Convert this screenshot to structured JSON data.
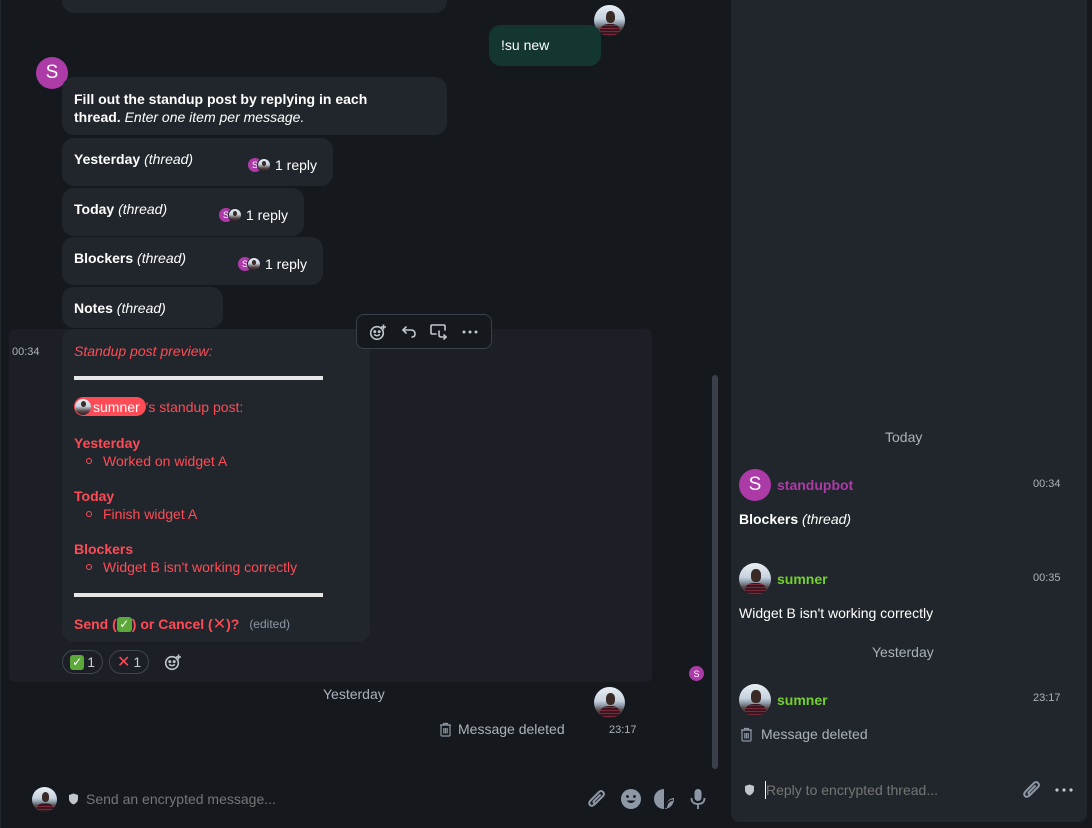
{
  "colors": {
    "accent_red": "#ff4b55",
    "bot_purple": "#ac3ba8",
    "sumner_green": "#74d12c",
    "own_bubble": "#133631",
    "bubble": "#21262c",
    "background": "#15191e"
  },
  "timeline": {
    "own_message": {
      "text": "!su new"
    },
    "bot_avatar_letter": "S",
    "intro": {
      "bold": "Fill out the standup post by replying in each thread.",
      "italic": "Enter one item per message."
    },
    "threads": [
      {
        "title": "Yesterday",
        "suffix": "(thread)",
        "reply_count": "1 reply"
      },
      {
        "title": "Today",
        "suffix": "(thread)",
        "reply_count": "1 reply"
      },
      {
        "title": "Blockers",
        "suffix": "(thread)",
        "reply_count": "1 reply"
      },
      {
        "title": "Notes",
        "suffix": "(thread)",
        "reply_count": ""
      }
    ],
    "hover_toolbar": {
      "react": "react-icon",
      "reply": "reply-icon",
      "thread": "thread-icon",
      "options": "more-options-icon"
    },
    "preview": {
      "timestamp": "00:34",
      "heading": "Standup post preview:",
      "user_pill": "sumner",
      "user_suffix": "'s standup post:",
      "sections": [
        {
          "title": "Yesterday",
          "items": [
            "Worked on widget A"
          ]
        },
        {
          "title": "Today",
          "items": [
            "Finish widget A"
          ]
        },
        {
          "title": "Blockers",
          "items": [
            "Widget B isn't working correctly"
          ]
        }
      ],
      "prompt_send": "Send (",
      "prompt_check": "✓",
      "prompt_mid": ") or Cancel (",
      "prompt_cross": "✕",
      "prompt_end": ")?",
      "edited": "(edited)"
    },
    "reactions": [
      {
        "emoji": "✓",
        "count": "1"
      },
      {
        "emoji": "✕",
        "count": "1"
      }
    ],
    "read_receipt_letter": "S",
    "date_separator": "Yesterday",
    "deleted": {
      "text": "Message deleted",
      "timestamp": "23:17"
    },
    "composer": {
      "placeholder": "Send an encrypted message..."
    }
  },
  "thread_panel": {
    "date_today": "Today",
    "date_yesterday": "Yesterday",
    "messages": [
      {
        "sender": "standupbot",
        "avatar_letter": "S",
        "time": "00:34",
        "body_bold": "Blockers",
        "body_italic": "(thread)"
      },
      {
        "sender": "sumner",
        "time": "00:35",
        "body": "Widget B isn't working correctly"
      },
      {
        "sender": "sumner",
        "time": "23:17",
        "body": "Message deleted"
      }
    ],
    "composer": {
      "placeholder": "Reply to encrypted thread..."
    }
  }
}
